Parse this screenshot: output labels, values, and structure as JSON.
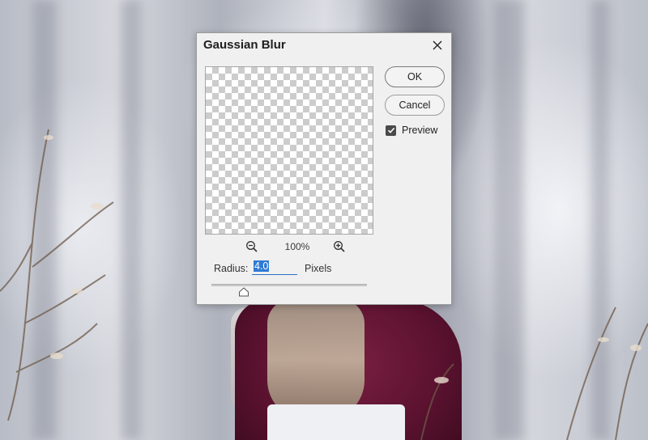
{
  "dialog": {
    "title": "Gaussian Blur",
    "ok_label": "OK",
    "cancel_label": "Cancel",
    "preview_label": "Preview",
    "preview_checked": true,
    "zoom_level": "100%",
    "radius_label": "Radius:",
    "radius_value": "4.0",
    "units_label": "Pixels",
    "icons": {
      "close": "close-icon",
      "zoom_out": "zoom-out-icon",
      "zoom_in": "zoom-in-icon",
      "check": "checkmark-icon",
      "slider_thumb": "slider-thumb-icon"
    },
    "colors": {
      "dialog_bg": "#f0f0f0",
      "selection": "#2f7bd6",
      "checkbox": "#4a4a4a"
    }
  }
}
